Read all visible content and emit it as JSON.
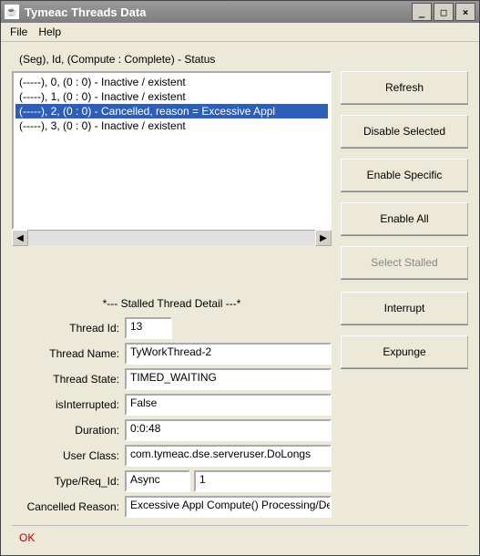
{
  "window": {
    "title": "Tymeac Threads Data"
  },
  "menu": {
    "file": "File",
    "help": "Help"
  },
  "list_header": "(Seg), Id, (Compute : Complete)   -   Status",
  "threads": [
    "(-----), 0,  (0 : 0) - Inactive / existent",
    "(-----), 1,  (0 : 0) - Inactive / existent",
    "(-----), 2,  (0 : 0) - Cancelled, reason = Excessive Appl",
    "(-----), 3,  (0 : 0) - Inactive / existent"
  ],
  "threads_selected_index": 2,
  "buttons": {
    "refresh": "Refresh",
    "disable_selected": "Disable Selected",
    "enable_specific": "Enable Specific",
    "enable_all": "Enable All",
    "select_stalled": "Select Stalled",
    "interrupt": "Interrupt",
    "expunge": "Expunge"
  },
  "section_header": "*--- Stalled Thread Detail ---*",
  "labels": {
    "thread_id": "Thread Id:",
    "thread_name": "Thread Name:",
    "thread_state": "Thread State:",
    "is_interrupted": "isInterrupted:",
    "duration": "Duration:",
    "user_class": "User Class:",
    "type_req_id": "Type/Req_Id:",
    "cancelled_reason": "Cancelled Reason:"
  },
  "detail": {
    "thread_id": "13",
    "thread_name": "TyWorkThread-2",
    "thread_state": "TIMED_WAITING",
    "is_interrupted": "False",
    "duration": "0:0:48",
    "user_class": "com.tymeac.dse.serveruser.DoLongs",
    "type": "Async",
    "req_id": "1",
    "cancelled_reason": "Excessive Appl Compute() Processing/Default Time"
  },
  "status": "OK"
}
